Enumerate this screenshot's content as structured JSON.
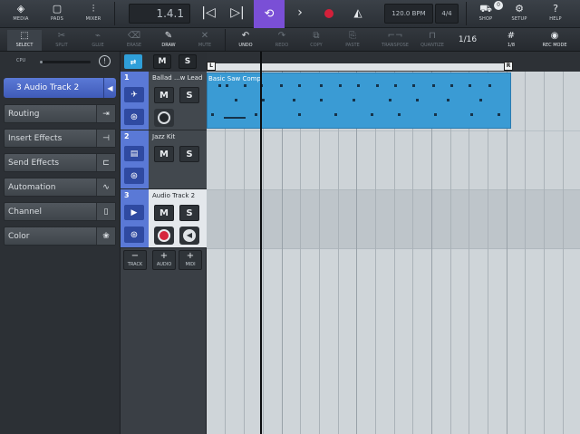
{
  "topbar": {
    "media": "MEDIA",
    "pads": "PADS",
    "mixer": "MIXER",
    "position": "1.4.1",
    "tempo": "120.0 BPM",
    "signature": "4/4",
    "shop": "SHOP",
    "shop_badge": "0",
    "setup": "SETUP",
    "help": "HELP"
  },
  "toolbar": {
    "select": "SELECT",
    "split": "SPLIT",
    "glue": "GLUE",
    "erase": "ERASE",
    "draw": "DRAW",
    "mute": "MUTE",
    "undo": "UNDO",
    "redo": "REDO",
    "copy": "COPY",
    "paste": "PASTE",
    "transpose": "TRANSPOSE",
    "quantize": "QUANTIZE",
    "quantize_value": "1/16",
    "grid_value": "1/8",
    "rec_mode": "REC MODE"
  },
  "leftpanel": {
    "cpu_label": "CPU",
    "cpu_load": 0.05,
    "selected_track": "Audio Track 2",
    "selected_track_number": "3",
    "items": [
      {
        "label": "Routing"
      },
      {
        "label": "Insert Effects"
      },
      {
        "label": "Send Effects"
      },
      {
        "label": "Automation"
      },
      {
        "label": "Channel"
      },
      {
        "label": "Color"
      }
    ]
  },
  "header_buttons": {
    "mute": "M",
    "solo": "S"
  },
  "tracks": [
    {
      "number": "1",
      "name": "Ballad ...w Lead",
      "mute": "M",
      "solo": "S"
    },
    {
      "number": "2",
      "name": "Jazz Kit",
      "mute": "M",
      "solo": "S"
    },
    {
      "number": "3",
      "name": "Audio Track 2",
      "mute": "M",
      "solo": "S"
    }
  ],
  "track_actions": [
    {
      "symbol": "−",
      "label": "TRACK"
    },
    {
      "symbol": "+",
      "label": "AUDIO"
    },
    {
      "symbol": "+",
      "label": "MIDI"
    }
  ],
  "arrange": {
    "loop_left": "L",
    "loop_right": "R",
    "event_name": "Basic Saw Comp"
  }
}
